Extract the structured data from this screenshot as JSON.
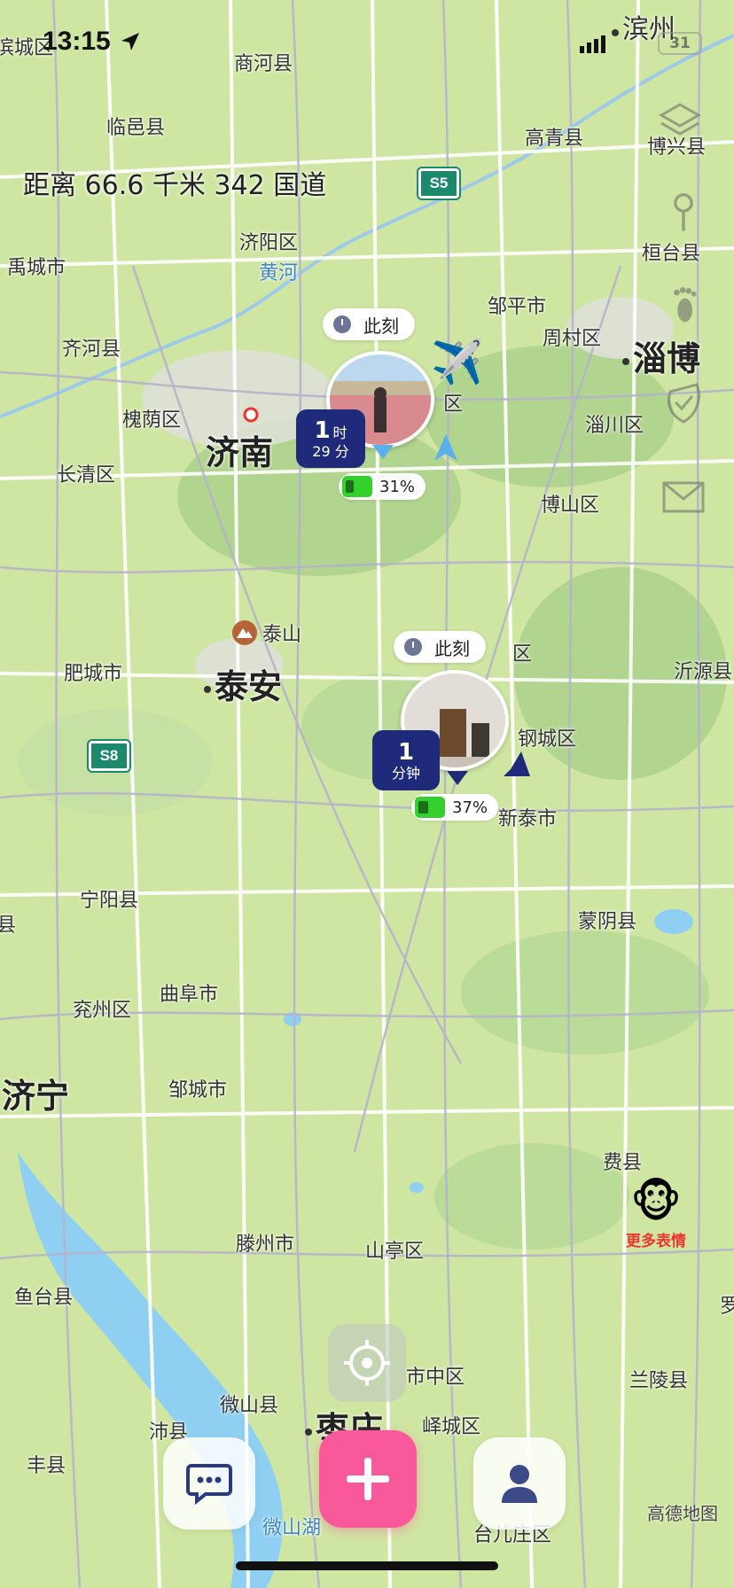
{
  "status_bar": {
    "time": "13:15",
    "battery": "31"
  },
  "distance_text": "距离 66.6 千米 342 国道",
  "map": {
    "labels": [
      {
        "id": "binzhou",
        "text": "滨州"
      },
      {
        "id": "binchengqu",
        "text": "滨城区"
      },
      {
        "id": "shanghexian",
        "text": "商河县"
      },
      {
        "id": "linyixian",
        "text": "临邑县"
      },
      {
        "id": "gaoqingxian",
        "text": "高青县"
      },
      {
        "id": "boxingxian",
        "text": "博兴县"
      },
      {
        "id": "jiyangqu",
        "text": "济阳区"
      },
      {
        "id": "huanghe",
        "text": "黄河"
      },
      {
        "id": "yuchengshi",
        "text": "禹城市"
      },
      {
        "id": "huantaixian",
        "text": "桓台县"
      },
      {
        "id": "zoupingshi",
        "text": "邹平市"
      },
      {
        "id": "zhoucunqu",
        "text": "周村区"
      },
      {
        "id": "zibo",
        "text": "淄博"
      },
      {
        "id": "qihexian",
        "text": "齐河县"
      },
      {
        "id": "huaiyinqu",
        "text": "槐荫区"
      },
      {
        "id": "jinan",
        "text": "济南"
      },
      {
        "id": "zhangqiuqu",
        "text": "区"
      },
      {
        "id": "zichuanqu",
        "text": "淄川区"
      },
      {
        "id": "changqingqu",
        "text": "长清区"
      },
      {
        "id": "boshanqu",
        "text": "博山区"
      },
      {
        "id": "taishan",
        "text": "泰山"
      },
      {
        "id": "feichengshi",
        "text": "肥城市"
      },
      {
        "id": "taian",
        "text": "泰安"
      },
      {
        "id": "laiwu",
        "text": "区"
      },
      {
        "id": "yiyuanxian",
        "text": "沂源县"
      },
      {
        "id": "gangchengqu",
        "text": "钢城区"
      },
      {
        "id": "xintaishi",
        "text": "新泰市"
      },
      {
        "id": "ningyangxian",
        "text": "宁阳县"
      },
      {
        "id": "mengyinxian",
        "text": "蒙阴县"
      },
      {
        "id": "qufushi",
        "text": "曲阜市"
      },
      {
        "id": "yanzhouqu",
        "text": "兖州区"
      },
      {
        "id": "jining",
        "text": "济宁"
      },
      {
        "id": "zouchengshi",
        "text": "邹城市"
      },
      {
        "id": "feixian",
        "text": "费县"
      },
      {
        "id": "tengzhoushi",
        "text": "滕州市"
      },
      {
        "id": "shantingqu",
        "text": "山亭区"
      },
      {
        "id": "yutaixian",
        "text": "鱼台县"
      },
      {
        "id": "shizhongqu",
        "text": "市中区"
      },
      {
        "id": "lanlingxian",
        "text": "兰陵县"
      },
      {
        "id": "weishanxian",
        "text": "微山县"
      },
      {
        "id": "peixian",
        "text": "沛县"
      },
      {
        "id": "zaozhuang",
        "text": "枣庄"
      },
      {
        "id": "yichengqu",
        "text": "峄城区"
      },
      {
        "id": "fengxian",
        "text": "丰县"
      },
      {
        "id": "weishanhu",
        "text": "微山湖"
      },
      {
        "id": "taierzhuangqu",
        "text": "台儿庄区"
      },
      {
        "id": "xian_left",
        "text": "县"
      },
      {
        "id": "luo_right",
        "text": "罗"
      }
    ],
    "shields": [
      {
        "id": "s5",
        "text": "S5"
      },
      {
        "id": "s8",
        "text": "S8"
      }
    ]
  },
  "user_pins": [
    {
      "id": "pin-1",
      "now_label": "此刻",
      "time_num": "1",
      "time_unit": "时",
      "time_sub": "29 分",
      "battery": "31%",
      "battery_level": 0.31
    },
    {
      "id": "pin-2",
      "now_label": "此刻",
      "time_num": "1",
      "time_sub": "分钟",
      "battery": "37%",
      "battery_level": 0.37
    }
  ],
  "emoji_button": {
    "emoji": "🐵",
    "label": "更多表情"
  },
  "map_logo": "高德地图",
  "colors": {
    "map_bg": "#cfe6a2",
    "badge": "#1f2a7a",
    "add_button": "#f9589a",
    "battery_green": "#34d12e",
    "emoji_label": "#ee3333"
  },
  "icons": {
    "side": [
      "layers-icon",
      "pin-icon",
      "footprint-icon",
      "check-shield-icon",
      "mail-icon"
    ],
    "bottom": [
      "chat-icon",
      "plus-icon",
      "profile-icon"
    ]
  }
}
